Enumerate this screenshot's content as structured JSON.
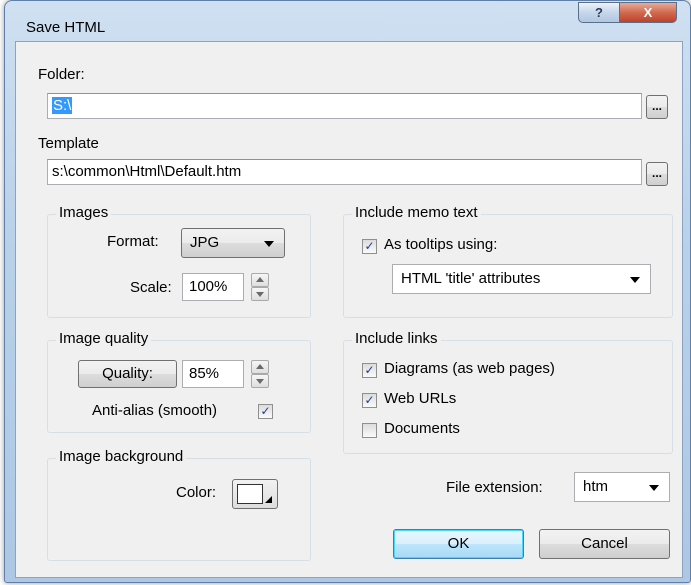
{
  "window": {
    "title": "Save HTML",
    "help_label": "?",
    "close_label": "X"
  },
  "folder": {
    "label": "Folder:",
    "value": "S:\\",
    "browse_label": "..."
  },
  "template": {
    "label": "Template",
    "value": "s:\\common\\Html\\Default.htm",
    "browse_label": "..."
  },
  "images": {
    "group_title": "Images",
    "format_label": "Format:",
    "format_value": "JPG",
    "scale_label": "Scale:",
    "scale_value": "100%"
  },
  "memo": {
    "group_title": "Include memo text",
    "tooltips_label": "As tooltips using:",
    "tooltips_checked": true,
    "tooltips_mode": "HTML 'title' attributes"
  },
  "quality": {
    "group_title": "Image quality",
    "quality_button": "Quality:",
    "quality_value": "85%",
    "antialias_label": "Anti-alias (smooth)",
    "antialias_checked": true
  },
  "links": {
    "group_title": "Include links",
    "diagrams_label": "Diagrams (as web pages)",
    "diagrams_checked": true,
    "weburls_label": "Web URLs",
    "weburls_checked": true,
    "documents_label": "Documents",
    "documents_checked": false
  },
  "background": {
    "group_title": "Image background",
    "color_label": "Color:",
    "color_value": "#ffffff"
  },
  "file_extension": {
    "label": "File extension:",
    "value": "htm"
  },
  "buttons": {
    "ok": "OK",
    "cancel": "Cancel"
  },
  "check_glyph": "✓"
}
